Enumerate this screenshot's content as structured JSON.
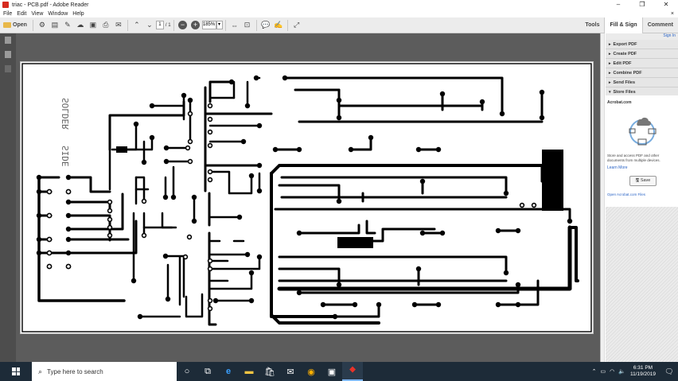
{
  "window": {
    "title": "triac - PCB.pdf - Adobe Reader",
    "controls": [
      "–",
      "❐",
      "✕"
    ]
  },
  "menu": [
    "File",
    "Edit",
    "View",
    "Window",
    "Help"
  ],
  "menu_extra": "×",
  "toolbar": {
    "open_label": "Open",
    "page_current": "1",
    "page_total": "/ 1",
    "zoom_value": "185%",
    "zoom_drop": "▾"
  },
  "right_tabs": [
    "Tools",
    "Fill & Sign",
    "Comment"
  ],
  "panel": {
    "sign_in": "Sign In",
    "items": [
      {
        "label": "Export PDF",
        "arrow": "▸"
      },
      {
        "label": "Create PDF",
        "arrow": "▸"
      },
      {
        "label": "Edit PDF",
        "arrow": "▸"
      },
      {
        "label": "Combine PDF",
        "arrow": "▸"
      },
      {
        "label": "Send Files",
        "arrow": "▸"
      },
      {
        "label": "Store Files",
        "arrow": "▾"
      }
    ],
    "store": {
      "heading": "Acrobat.com",
      "description": "Store and access PDF and other documents from multiple devices.",
      "learn_more": "Learn More",
      "save_label": "Save",
      "open_files": "Open Acrobat.com Files"
    }
  },
  "pcb": {
    "mirror_text_top": "SOLDER",
    "mirror_text_bottom": "SIDE"
  },
  "taskbar": {
    "search_placeholder": "Type here to search",
    "time": "6:31 PM",
    "date": "11/19/2019",
    "notifications": "2"
  },
  "colors": {
    "accent": "#2a64c6",
    "taskbar": "#1d2b38",
    "doc_bg": "#5c5c5c"
  }
}
